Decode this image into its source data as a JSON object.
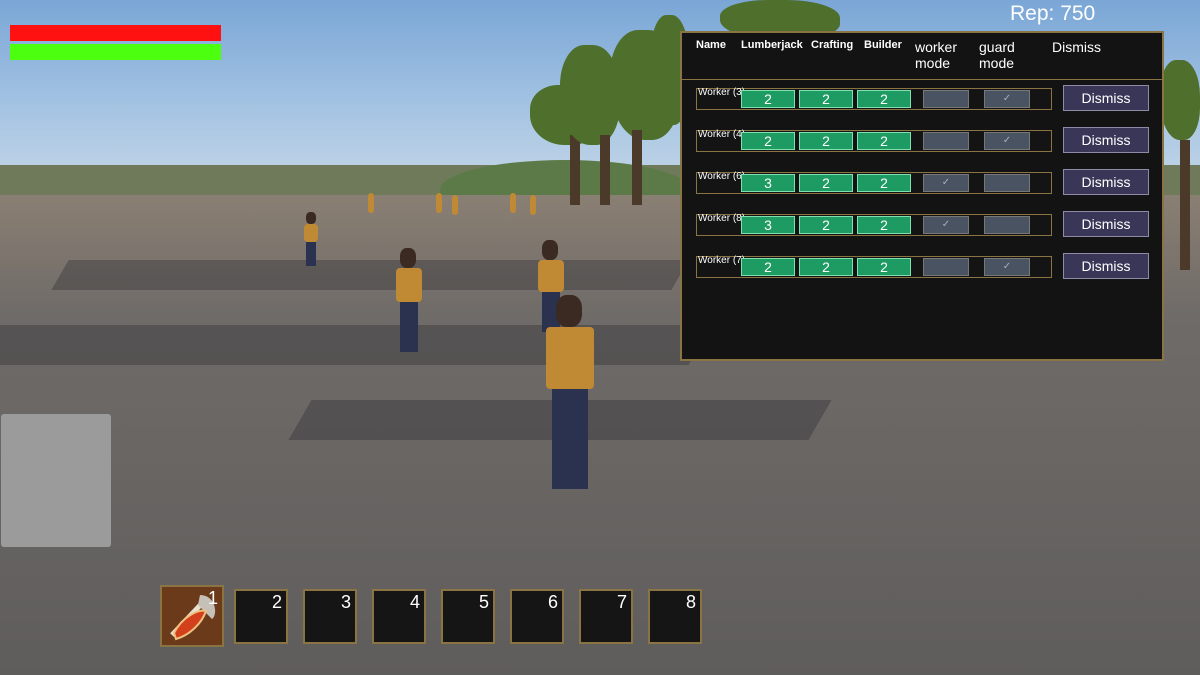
{
  "hud": {
    "rep": "Rep: 750",
    "health_color": "#ff1111",
    "stamina_color": "#4cff0e"
  },
  "workers_panel": {
    "headers": {
      "name": "Name",
      "lumberjack": "Lumberjack",
      "crafting": "Crafting",
      "builder": "Builder",
      "worker_mode": "worker mode",
      "guard_mode": "guard mode",
      "dismiss": "Dismiss"
    },
    "rows": [
      {
        "name": "Worker (3)",
        "lumberjack": "2",
        "crafting": "2",
        "builder": "2",
        "worker_mode": "",
        "guard_mode": "✓",
        "dismiss": "Dismiss"
      },
      {
        "name": "Worker (4)",
        "lumberjack": "2",
        "crafting": "2",
        "builder": "2",
        "worker_mode": "",
        "guard_mode": "✓",
        "dismiss": "Dismiss"
      },
      {
        "name": "Worker (6)",
        "lumberjack": "3",
        "crafting": "2",
        "builder": "2",
        "worker_mode": "✓",
        "guard_mode": "",
        "dismiss": "Dismiss"
      },
      {
        "name": "Worker (8)",
        "lumberjack": "3",
        "crafting": "2",
        "builder": "2",
        "worker_mode": "✓",
        "guard_mode": "",
        "dismiss": "Dismiss"
      },
      {
        "name": "Worker (7)",
        "lumberjack": "2",
        "crafting": "2",
        "builder": "2",
        "worker_mode": "",
        "guard_mode": "✓",
        "dismiss": "Dismiss"
      }
    ]
  },
  "hotbar": {
    "slots": [
      "1",
      "2",
      "3",
      "4",
      "5",
      "6",
      "7",
      "8"
    ],
    "slot1_item_icon": "axe-icon"
  }
}
